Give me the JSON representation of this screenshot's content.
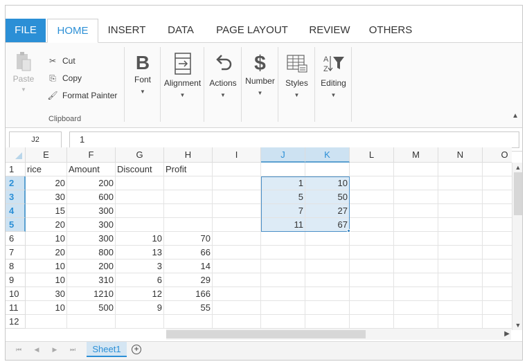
{
  "tabs": [
    "FILE",
    "HOME",
    "INSERT",
    "DATA",
    "PAGE LAYOUT",
    "REVIEW",
    "OTHERS"
  ],
  "active_tab": "HOME",
  "ribbon": {
    "clipboard": {
      "paste": "Paste",
      "cut": "Cut",
      "copy": "Copy",
      "format_painter": "Format Painter",
      "label": "Clipboard"
    },
    "font": "Font",
    "alignment": "Alignment",
    "actions": "Actions",
    "number": "Number",
    "styles": "Styles",
    "editing": "Editing"
  },
  "formula_bar": {
    "name_box": "J2",
    "value": "1"
  },
  "columns": [
    "E",
    "F",
    "G",
    "H",
    "I",
    "J",
    "K",
    "L",
    "M",
    "N",
    "O"
  ],
  "rows": [
    "1",
    "2",
    "3",
    "4",
    "5",
    "6",
    "7",
    "8",
    "9",
    "10",
    "11",
    "12"
  ],
  "cells": [
    [
      "rice",
      "Amount",
      "Discount",
      "Profit",
      "",
      "",
      "",
      "",
      "",
      "",
      ""
    ],
    [
      "20",
      "200",
      "",
      "",
      "",
      "1",
      "10",
      "",
      "",
      "",
      ""
    ],
    [
      "30",
      "600",
      "",
      "",
      "",
      "5",
      "50",
      "",
      "",
      "",
      ""
    ],
    [
      "15",
      "300",
      "",
      "",
      "",
      "7",
      "27",
      "",
      "",
      "",
      ""
    ],
    [
      "20",
      "300",
      "",
      "",
      "",
      "11",
      "67",
      "",
      "",
      "",
      ""
    ],
    [
      "10",
      "300",
      "10",
      "70",
      "",
      "",
      "",
      "",
      "",
      "",
      ""
    ],
    [
      "20",
      "800",
      "13",
      "66",
      "",
      "",
      "",
      "",
      "",
      "",
      ""
    ],
    [
      "10",
      "200",
      "3",
      "14",
      "",
      "",
      "",
      "",
      "",
      "",
      ""
    ],
    [
      "10",
      "310",
      "6",
      "29",
      "",
      "",
      "",
      "",
      "",
      "",
      ""
    ],
    [
      "30",
      "1210",
      "12",
      "166",
      "",
      "",
      "",
      "",
      "",
      "",
      ""
    ],
    [
      "10",
      "500",
      "9",
      "55",
      "",
      "",
      "",
      "",
      "",
      "",
      ""
    ],
    [
      "",
      "",
      "",
      "",
      "",
      "",
      "",
      "",
      "",
      "",
      ""
    ]
  ],
  "selection": {
    "columns": [
      "J",
      "K"
    ],
    "rows": [
      "2",
      "3",
      "4",
      "5"
    ]
  },
  "sheet_tabs": [
    "Sheet1"
  ],
  "colors": {
    "accent": "#2b8fd6",
    "selection_fill": "#ddebf6",
    "header_selected": "#cde2f2"
  }
}
